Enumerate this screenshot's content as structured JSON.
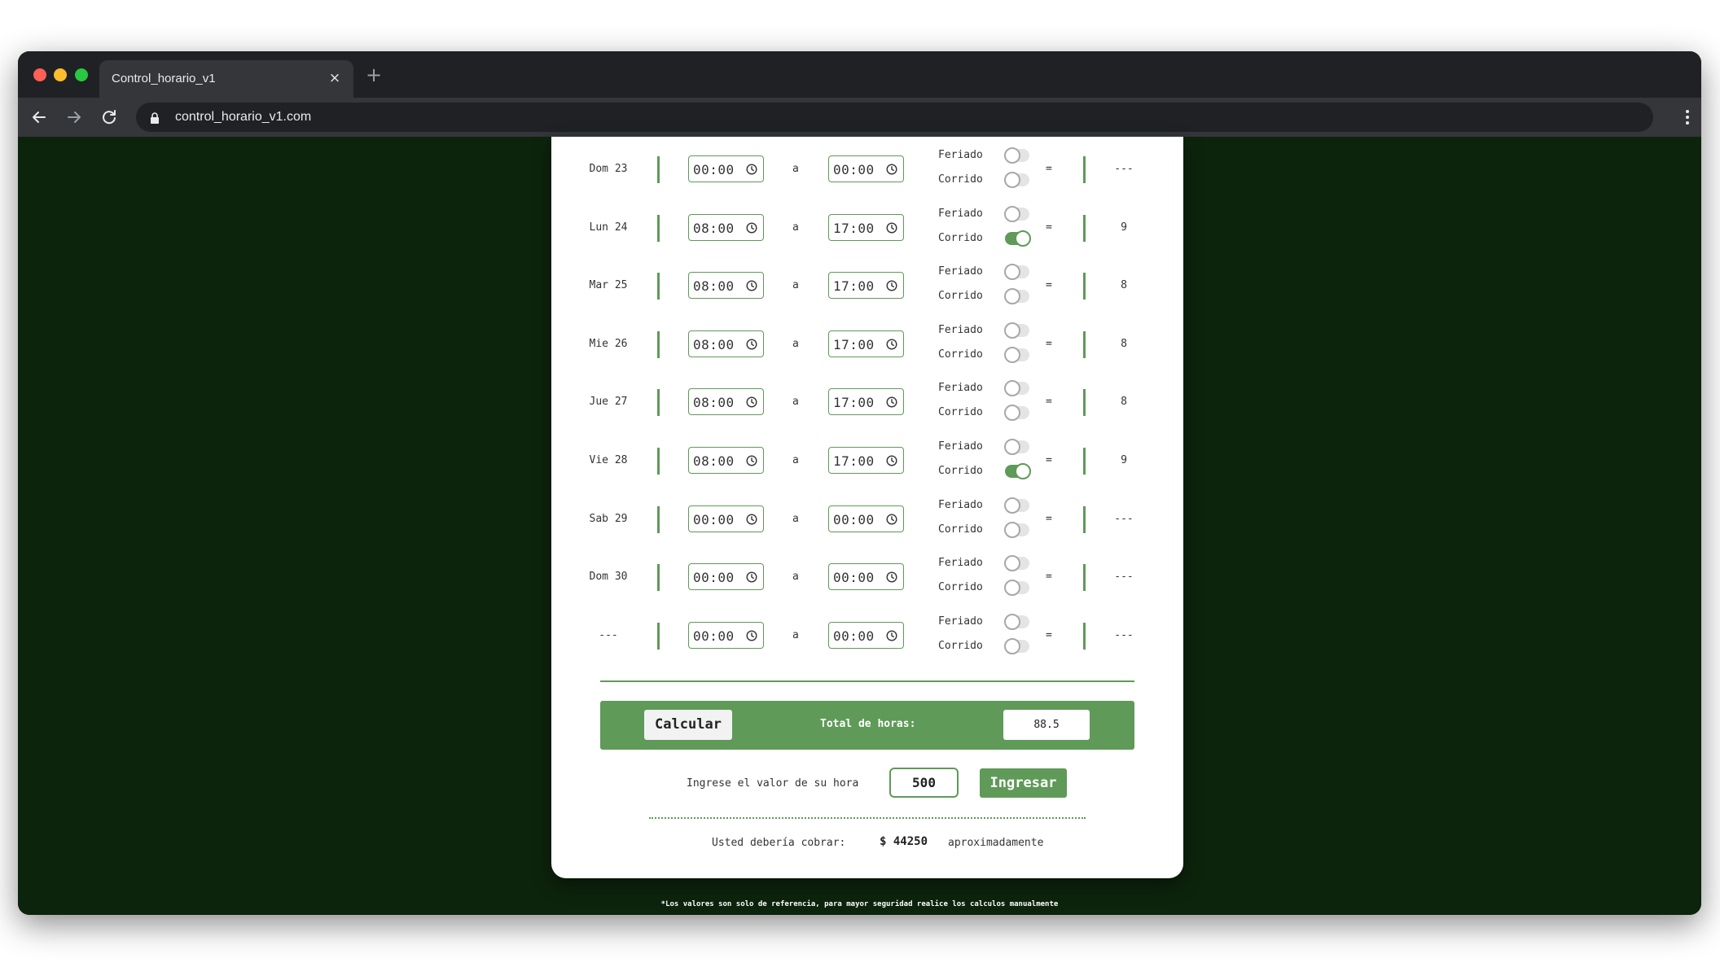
{
  "browser": {
    "tab_title": "Control_horario_v1",
    "tab_close": "×",
    "new_tab": "+",
    "url": "control_horario_v1.com"
  },
  "days": [
    {
      "label": "Dom 23",
      "start": "00:00",
      "end": "00:00",
      "feriado": false,
      "corrido": false,
      "hours": "---"
    },
    {
      "label": "Lun 24",
      "start": "08:00",
      "end": "17:00",
      "feriado": false,
      "corrido": true,
      "hours": "9"
    },
    {
      "label": "Mar 25",
      "start": "08:00",
      "end": "17:00",
      "feriado": false,
      "corrido": false,
      "hours": "8"
    },
    {
      "label": "Mie 26",
      "start": "08:00",
      "end": "17:00",
      "feriado": false,
      "corrido": false,
      "hours": "8"
    },
    {
      "label": "Jue 27",
      "start": "08:00",
      "end": "17:00",
      "feriado": false,
      "corrido": false,
      "hours": "8"
    },
    {
      "label": "Vie 28",
      "start": "08:00",
      "end": "17:00",
      "feriado": false,
      "corrido": true,
      "hours": "9"
    },
    {
      "label": "Sab 29",
      "start": "00:00",
      "end": "00:00",
      "feriado": false,
      "corrido": false,
      "hours": "---"
    },
    {
      "label": "Dom 30",
      "start": "00:00",
      "end": "00:00",
      "feriado": false,
      "corrido": false,
      "hours": "---"
    },
    {
      "label": "---",
      "start": "00:00",
      "end": "00:00",
      "feriado": false,
      "corrido": false,
      "hours": "---"
    }
  ],
  "labels": {
    "a": "a",
    "feriado": "Feriado",
    "corrido": "Corrido",
    "equals": "="
  },
  "calc": {
    "button": "Calcular",
    "total_label": "Total de horas:",
    "total_value": "88.5"
  },
  "rate": {
    "label": "Ingrese el valor de su hora",
    "value": "500",
    "button": "Ingresar"
  },
  "result": {
    "label": "Usted debería cobrar:",
    "value": "$ 44250",
    "suffix": "aproximadamente"
  },
  "footer_note": "*Los valores son solo de referencia, para mayor seguridad realice los calculos manualmente",
  "colors": {
    "accent": "#5f9a58",
    "background": "#0d240c"
  },
  "icons": [
    "back-arrow-icon",
    "forward-arrow-icon",
    "reload-icon",
    "lock-icon",
    "kebab-menu-icon",
    "clock-icon"
  ]
}
